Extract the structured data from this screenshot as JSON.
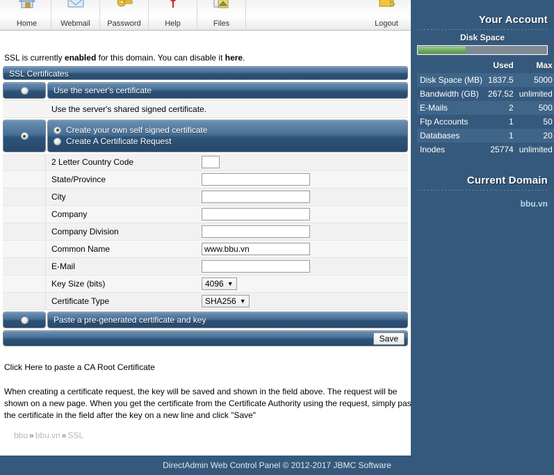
{
  "topnav": {
    "items": [
      {
        "label": "Home",
        "icon": "home-icon"
      },
      {
        "label": "Webmail",
        "icon": "envelope-icon"
      },
      {
        "label": "Password",
        "icon": "key-icon"
      },
      {
        "label": "Help",
        "icon": "pin-icon"
      },
      {
        "label": "Files",
        "icon": "files-icon"
      }
    ],
    "logout": {
      "label": "Logout",
      "icon": "folder-arrow-icon"
    }
  },
  "status": {
    "prefix": "SSL is currently ",
    "state": "enabled",
    "middle": " for this domain. You can disable it ",
    "link": "here",
    "suffix": "."
  },
  "panel": {
    "title": "SSL Certificates",
    "option_server_cert": "Use the server's certificate",
    "option_server_cert_desc": "Use the server's shared signed certificate.",
    "option_self_signed": "Create your own self signed certificate",
    "option_cert_request": "Create A Certificate Request",
    "option_paste": "Paste a pre-generated certificate and key",
    "save_label": "Save"
  },
  "fields": [
    {
      "name": "2 Letter Country Code",
      "type": "text",
      "value": "",
      "size": "small"
    },
    {
      "name": "State/Province",
      "type": "text",
      "value": "",
      "size": "wide"
    },
    {
      "name": "City",
      "type": "text",
      "value": "",
      "size": "wide"
    },
    {
      "name": "Company",
      "type": "text",
      "value": "",
      "size": "wide"
    },
    {
      "name": "Company Division",
      "type": "text",
      "value": "",
      "size": "wide"
    },
    {
      "name": "Common Name",
      "type": "text",
      "value": "www.bbu.vn",
      "size": "wide"
    },
    {
      "name": "E-Mail",
      "type": "text",
      "value": "",
      "size": "wide"
    },
    {
      "name": "Key Size (bits)",
      "type": "select",
      "value": "4096",
      "size": ""
    },
    {
      "name": "Certificate Type",
      "type": "select",
      "value": "SHA256",
      "size": ""
    }
  ],
  "notes": {
    "ca_link": "Click Here to paste a CA Root Certificate",
    "paragraph": "When creating a certificate request, the key will be saved and shown in the field above. The request will be shown on a new page. When you get the certificate from the Certificate Authority using the request, simply paste the certificate in the field after the key on a new line and click \"Save\""
  },
  "breadcrumb": {
    "items": [
      "bbu",
      "bbu.vn",
      "SSL"
    ],
    "separator": "»"
  },
  "sidebar": {
    "account_title": "Your Account",
    "disk_space_label": "Disk Space",
    "disk_space_percent": 37,
    "columns": [
      "",
      "Used",
      "Max"
    ],
    "rows": [
      {
        "label": "Disk Space (MB)",
        "used": "1837.5",
        "max": "5000"
      },
      {
        "label": "Bandwidth (GB)",
        "used": "267.52",
        "max": "unlimited"
      },
      {
        "label": "E-Mails",
        "used": "2",
        "max": "500"
      },
      {
        "label": "Ftp Accounts",
        "used": "1",
        "max": "50"
      },
      {
        "label": "Databases",
        "used": "1",
        "max": "20"
      },
      {
        "label": "Inodes",
        "used": "25774",
        "max": "unlimited"
      }
    ],
    "current_domain_title": "Current Domain",
    "current_domain": "bbu.vn"
  },
  "footer": {
    "text": "DirectAdmin Web Control Panel © 2012-2017 JBMC Software"
  },
  "colors": {
    "accent": "#35597c",
    "bar": "#2c5479",
    "meter_fill": "#6eae5e",
    "domain_link": "#bcd6ee"
  }
}
